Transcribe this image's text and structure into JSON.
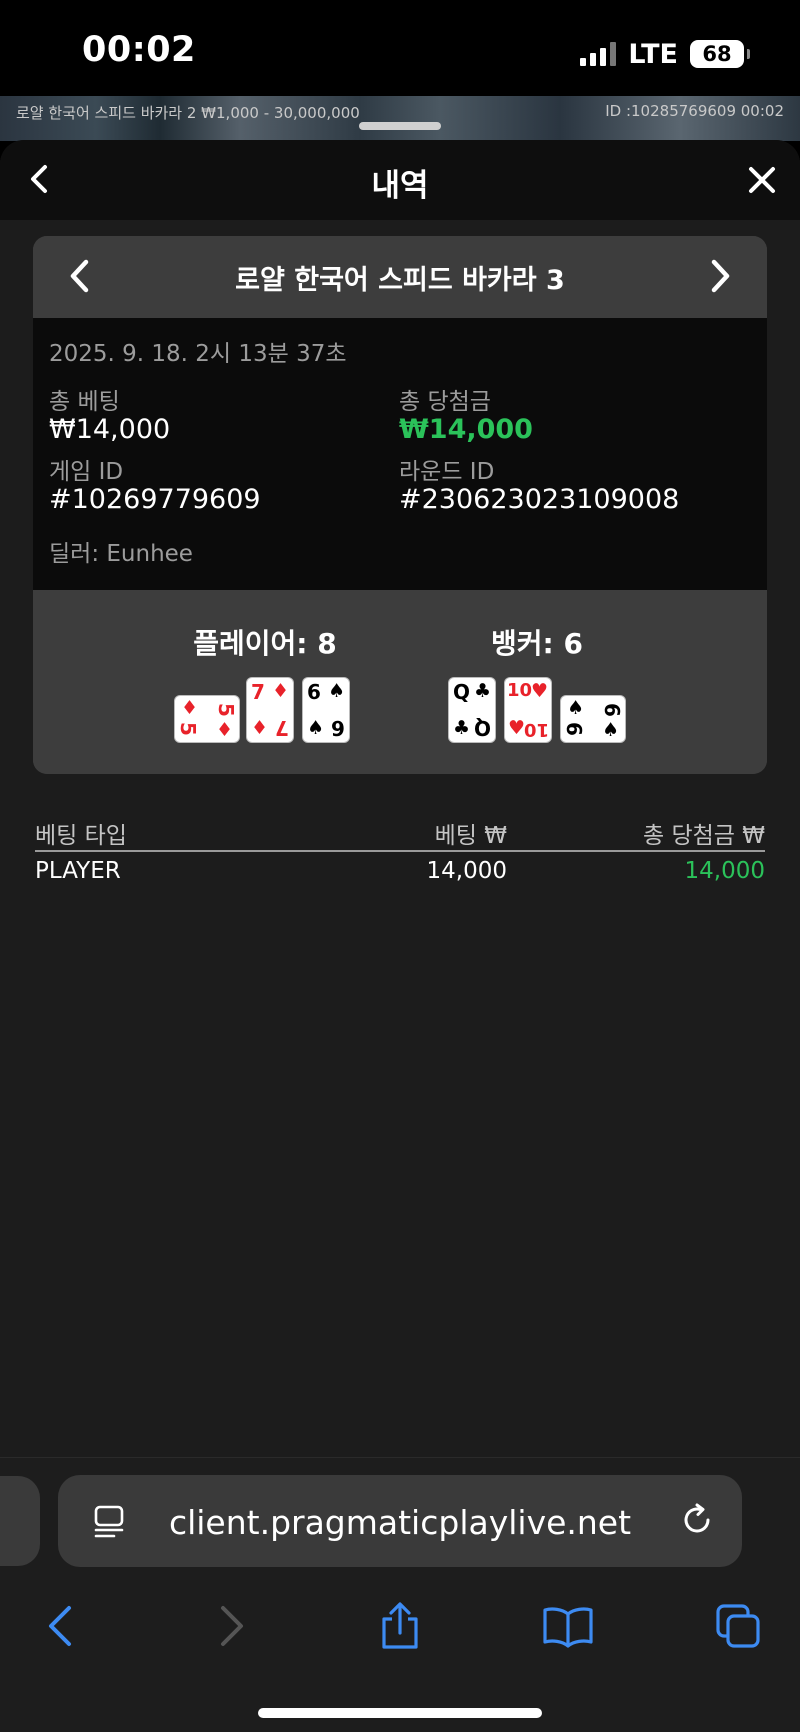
{
  "status_bar": {
    "time": "00:02",
    "network": "LTE",
    "battery": "68"
  },
  "background_game": {
    "table_text": "로얄 한국어 스피드 바카라 2 ₩1,000 - 30,000,000",
    "round_text": "ID :10285769609 00:02"
  },
  "sheet": {
    "title": "내역"
  },
  "card": {
    "game_name": "로얄 한국어 스피드 바카라 3",
    "datetime": "2025. 9. 18. 2시 13분 37초",
    "total_bet_label": "총 베팅",
    "total_bet_value": "₩14,000",
    "total_win_label": "총 당첨금",
    "total_win_value": "₩14,000",
    "game_id_label": "게임 ID",
    "game_id_value": "#10269779609",
    "round_id_label": "라운드 ID",
    "round_id_value": "#230623023109008",
    "dealer": "딜러: Eunhee",
    "player_label": "플레이어: 8",
    "banker_label": "뱅커: 6",
    "player_cards": [
      {
        "rank": "5",
        "suit": "♦",
        "rotated": true
      },
      {
        "rank": "7",
        "suit": "♦",
        "rotated": false
      },
      {
        "rank": "6",
        "suit": "♠",
        "rotated": false
      }
    ],
    "banker_cards": [
      {
        "rank": "Q",
        "suit": "♣",
        "rotated": false
      },
      {
        "rank": "10",
        "suit": "♥",
        "rotated": false
      },
      {
        "rank": "6",
        "suit": "♠",
        "rotated": true
      }
    ]
  },
  "bets_table": {
    "headers": {
      "type": "베팅 타입",
      "bet": "베팅 ₩",
      "win": "총 당첨금 ₩"
    },
    "rows": [
      {
        "type": "PLAYER",
        "bet": "14,000",
        "win": "14,000"
      }
    ]
  },
  "browser": {
    "url": "client.pragmaticplaylive.net"
  },
  "colors": {
    "win_green": "#2bc25a",
    "card_red": "#e8222a",
    "ios_blue": "#3d8bf2"
  }
}
